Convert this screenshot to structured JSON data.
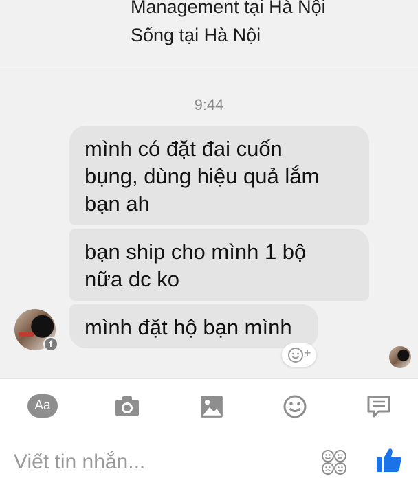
{
  "profile": {
    "work_line": "Management tại Hà Nội",
    "lives_line": "Sống tại Hà Nội"
  },
  "conversation": {
    "timestamp": "9:44",
    "messages": [
      {
        "lines": [
          "mình có đặt đai cuốn",
          "bụng, dùng hiệu quả lắm",
          "bạn ah"
        ]
      },
      {
        "lines": [
          "bạn ship cho mình 1 bộ",
          "nữa dc ko"
        ]
      },
      {
        "lines": [
          "mình đặt hộ bạn mình"
        ]
      }
    ],
    "sender_badge": "f"
  },
  "toolbar": {
    "text_style_label": "Aa",
    "icons": [
      "camera-icon",
      "image-icon",
      "emoji-icon",
      "quick-reply-icon"
    ]
  },
  "composer": {
    "placeholder": "Viết tin nhắn...",
    "sticker_icon": "sticker-faces-icon",
    "like_icon": "thumbs-up-icon"
  },
  "colors": {
    "background": "#f1f1f1",
    "bubble": "#e4e4e4",
    "icon_gray": "#8e8e8e",
    "like_blue": "#1a73e8"
  }
}
